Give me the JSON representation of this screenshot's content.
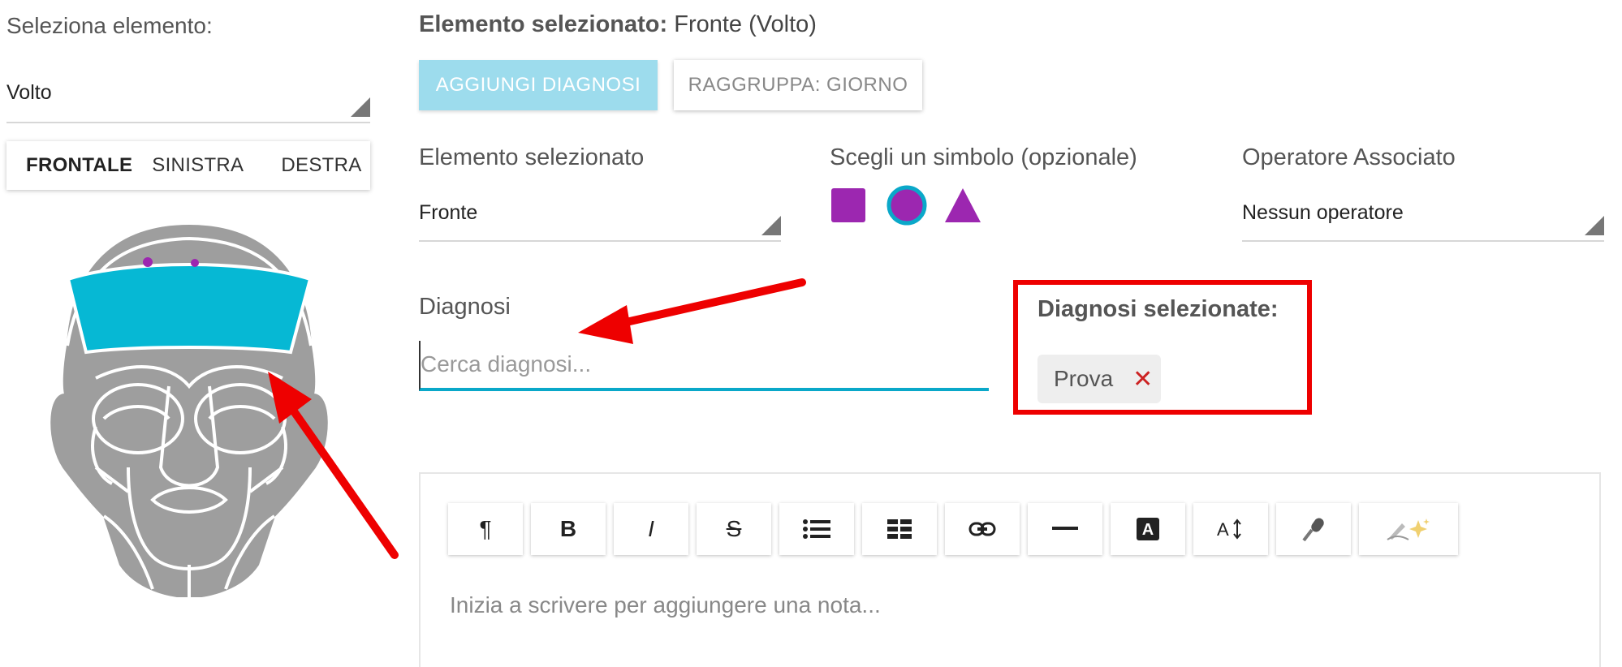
{
  "left_panel": {
    "select_label": "Seleziona elemento:",
    "element_value": "Volto",
    "view_tabs": [
      "FRONTALE",
      "SINISTRA",
      "DESTRA"
    ],
    "active_view": "FRONTALE"
  },
  "header": {
    "selected_prefix": "Elemento selezionato:",
    "selected_value": "Fronte (Volto)"
  },
  "buttons": {
    "add_diagnosis": "AGGIUNGI DIAGNOSI",
    "group_by": "RAGGRUPPA: GIORNO"
  },
  "fields": {
    "element_label": "Elemento selezionato",
    "element_value": "Fronte",
    "symbol_label": "Scegli un simbolo (opzionale)",
    "symbols": [
      "square",
      "circle",
      "triangle"
    ],
    "selected_symbol": "circle",
    "operator_label": "Operatore Associato",
    "operator_value": "Nessun operatore"
  },
  "diagnosi": {
    "label": "Diagnosi",
    "placeholder": "Cerca diagnosi...",
    "selected_title": "Diagnosi selezionate:",
    "selected": [
      {
        "name": "Prova",
        "remove": "✕"
      }
    ]
  },
  "editor": {
    "toolbar_icons": [
      "paragraph-icon",
      "bold-icon",
      "italic-icon",
      "strikethrough-icon",
      "bulleted-list-icon",
      "table-icon",
      "link-icon",
      "horizontal-rule-icon",
      "font-color-icon",
      "text-size-icon",
      "microphone-icon",
      "ai-writing-icon"
    ],
    "toolbar_glyphs": {
      "paragraph": "¶",
      "bold": "B",
      "italic": "I",
      "strike": "S"
    },
    "placeholder": "Inizia a scrivere per aggiungere una nota..."
  },
  "colors": {
    "accent": "#0aa8c9",
    "primary_button": "#9ddced",
    "forehead": "#06b8d4",
    "symbol": "#9c27b0",
    "face": "#9e9e9e",
    "annotation": "#ee0000"
  }
}
